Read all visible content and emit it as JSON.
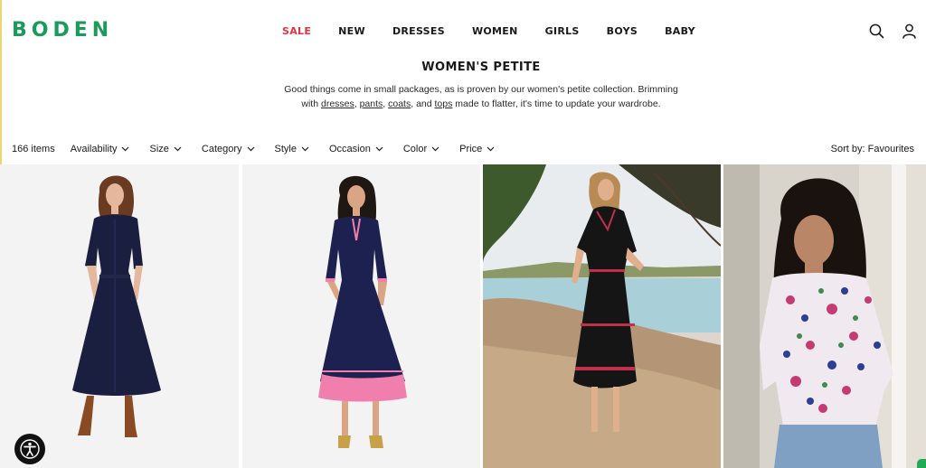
{
  "brand": {
    "logo_text": "BODEN",
    "brand_color": "#1a9a5b"
  },
  "nav": {
    "items": [
      {
        "label": "SALE",
        "highlight": "#e0333d"
      },
      {
        "label": "NEW"
      },
      {
        "label": "DRESSES"
      },
      {
        "label": "WOMEN"
      },
      {
        "label": "GIRLS"
      },
      {
        "label": "BOYS"
      },
      {
        "label": "BABY"
      }
    ]
  },
  "header_icons": [
    "search-icon",
    "account-icon"
  ],
  "page": {
    "title": "WOMEN'S PETITE",
    "intro_line1": "Good things come in small packages, as is proven by our women's petite collection. Brimming",
    "intro_with": "with ",
    "intro_links": [
      "dresses",
      "pants",
      "coats",
      "tops"
    ],
    "intro_sep1": ", ",
    "intro_sep2": ", ",
    "intro_and": ", and ",
    "intro_tail": " made to flatter, it's time to update your wardrobe."
  },
  "filters": {
    "item_count": "166 items",
    "options": [
      "Availability",
      "Size",
      "Category",
      "Style",
      "Occasion",
      "Color",
      "Price"
    ],
    "sort_label": "Sort by: Favourites"
  },
  "products": [
    {
      "name": "navy-shirt-dress",
      "dress_color": "#1b1f3f",
      "accent": "#1b1f3f",
      "bg": "#f3f3f3"
    },
    {
      "name": "navy-pink-trim-dress",
      "dress_color": "#1c2150",
      "accent": "#f07fae",
      "bg": "#f3f3f3"
    },
    {
      "name": "black-embroidered-dress",
      "dress_color": "#151515",
      "accent": "#c0304a",
      "bg": "#d8c3a8"
    },
    {
      "name": "floral-blouse",
      "dress_color": "#f0eaf0",
      "accent": "#c43a72",
      "bg": "#d8d4cc"
    }
  ],
  "accessibility": {
    "icon": "accessibility-icon"
  }
}
